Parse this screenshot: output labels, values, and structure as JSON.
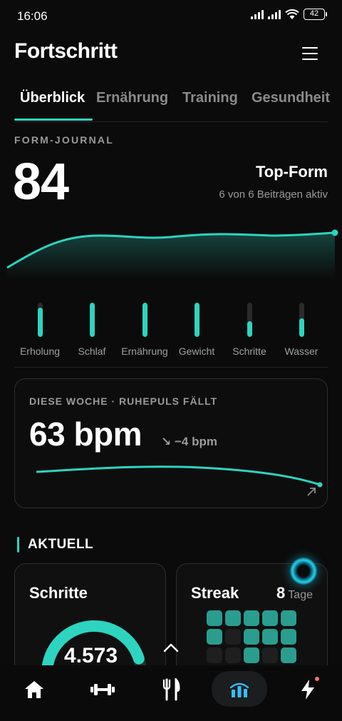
{
  "status": {
    "time": "16:06",
    "battery": "42"
  },
  "header": {
    "title": "Fortschritt"
  },
  "tabs": [
    {
      "label": "Überblick"
    },
    {
      "label": "Ernährung"
    },
    {
      "label": "Training"
    },
    {
      "label": "Gesundheit"
    }
  ],
  "journal": {
    "section_label": "FORM-JOURNAL",
    "score": "84",
    "status": "Top-Form",
    "subtitle": "6 von 6 Beiträgen aktiv"
  },
  "metrics": [
    {
      "label": "Erholung",
      "level": 0.85
    },
    {
      "label": "Schlaf",
      "level": 1.0
    },
    {
      "label": "Ernährung",
      "level": 1.0
    },
    {
      "label": "Gewicht",
      "level": 1.0
    },
    {
      "label": "Schritte",
      "level": 0.45
    },
    {
      "label": "Wasser",
      "level": 0.55
    }
  ],
  "week": {
    "label": "DIESE WOCHE · RUHEPULS FÄLLT",
    "value": "63 bpm",
    "delta": "↘ −4 bpm"
  },
  "aktuell": {
    "heading": "AKTUELL",
    "steps": {
      "title": "Schritte",
      "value": "4.573",
      "progress": 0.45
    },
    "streak": {
      "title": "Streak",
      "count": "8",
      "unit": "Tage",
      "cells": [
        1,
        1,
        1,
        1,
        1,
        1,
        0,
        1,
        1,
        1,
        0,
        0,
        1,
        0,
        1
      ]
    }
  },
  "colors": {
    "accent": "#2dd4bf",
    "background": "#0b0b0b"
  },
  "nav": [
    {
      "icon": "home-icon"
    },
    {
      "icon": "dumbbell-icon"
    },
    {
      "icon": "cutlery-icon"
    },
    {
      "icon": "stats-icon",
      "active": true
    },
    {
      "icon": "lightning-icon"
    }
  ]
}
